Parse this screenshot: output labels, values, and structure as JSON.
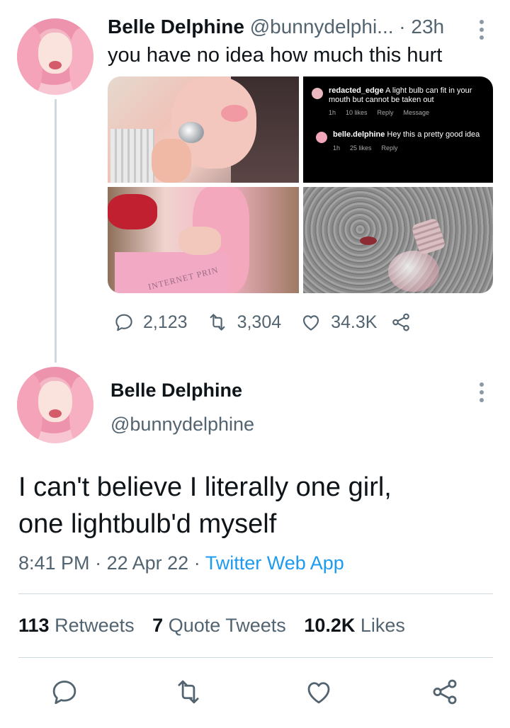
{
  "tweet1": {
    "author_name": "Belle Delphine",
    "handle": "@bunnydelphi...",
    "separator": "·",
    "time": "23h",
    "text": "you have no idea how much this hurt",
    "media": {
      "comment1": {
        "user": "redacted_edge",
        "text": "A light bulb can fit in your mouth but cannot be taken out",
        "time": "1h",
        "likes": "10 likes",
        "reply": "Reply",
        "message": "Message"
      },
      "comment2": {
        "user": "belle.delphine",
        "text": "Hey this a pretty good idea",
        "time": "1h",
        "likes": "25 likes",
        "reply": "Reply"
      },
      "shirt_text": "INTERNET PRIN"
    },
    "replies": "2,123",
    "retweets": "3,304",
    "likes": "34.3K"
  },
  "tweet2": {
    "author_name": "Belle Delphine",
    "handle": "@bunnydelphine",
    "text_line1": "I can't believe I literally one girl,",
    "text_line2": "one lightbulb'd myself",
    "time": "8:41 PM",
    "separator": "·",
    "date": "22 Apr 22",
    "source": "Twitter Web App",
    "retweets_count": "113",
    "retweets_label": "Retweets",
    "quotes_count": "7",
    "quotes_label": "Quote Tweets",
    "likes_count": "10.2K",
    "likes_label": "Likes"
  },
  "icons": [
    "reply-icon",
    "retweet-icon",
    "like-icon",
    "share-icon",
    "more-icon"
  ],
  "colors": {
    "text": "#0f1419",
    "secondary": "#536471",
    "link": "#1d9bf0",
    "divider": "#cfd9de"
  }
}
